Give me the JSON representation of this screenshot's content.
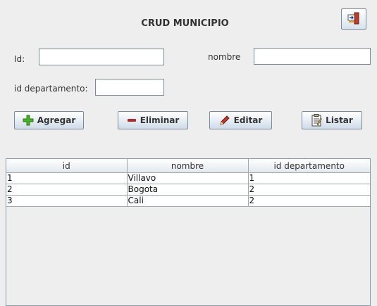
{
  "title": "CRUD MUNICIPIO",
  "form": {
    "id_label": "Id:",
    "id_value": "",
    "nombre_label": "nombre",
    "nombre_value": "",
    "id_departamento_label": "id departamento:",
    "id_departamento_value": ""
  },
  "buttons": {
    "agregar": "Agregar",
    "eliminar": "Eliminar",
    "editar": "Editar",
    "listar": "Listar"
  },
  "icons": {
    "exit": "exit-door-icon",
    "agregar": "plus-icon",
    "eliminar": "minus-icon",
    "editar": "pencil-icon",
    "listar": "clipboard-list-icon"
  },
  "colors": {
    "plus": "#4caf2a",
    "minus": "#b02a2a",
    "pencil": "#c0392b"
  },
  "table": {
    "columns": [
      "id",
      "nombre",
      "id departamento"
    ],
    "rows": [
      [
        "1",
        "Villavo",
        "1"
      ],
      [
        "2",
        "Bogota",
        "2"
      ],
      [
        "3",
        "Cali",
        "2"
      ]
    ]
  }
}
